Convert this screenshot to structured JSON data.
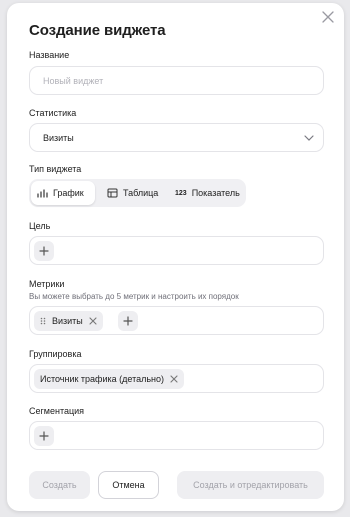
{
  "dialog": {
    "title": "Создание виджета",
    "close_icon": "close-icon"
  },
  "name": {
    "label": "Название",
    "placeholder": "Новый виджет",
    "value": ""
  },
  "statistics": {
    "label": "Статистика",
    "selected": "Визиты",
    "icon": "chevron-down-icon"
  },
  "widget_type": {
    "label": "Тип виджета",
    "options": [
      {
        "label": "График",
        "icon": "bar-chart-icon",
        "active": true
      },
      {
        "label": "Таблица",
        "icon": "table-icon",
        "active": false
      },
      {
        "label": "Показатель",
        "icon_text": "123",
        "active": false
      }
    ]
  },
  "goal": {
    "label": "Цель",
    "add_icon": "plus-icon"
  },
  "metrics": {
    "label": "Метрики",
    "hint": "Вы можете выбрать до 5 метрик и настроить их порядок",
    "chips": [
      {
        "label": "Визиты"
      }
    ]
  },
  "grouping": {
    "label": "Группировка",
    "chips": [
      {
        "label": "Источник трафика (детально)"
      }
    ]
  },
  "segmentation": {
    "label": "Сегментация",
    "add_icon": "plus-icon"
  },
  "footer": {
    "create_label": "Создать",
    "cancel_label": "Отмена",
    "create_edit_label": "Создать и отредактировать"
  },
  "colors": {
    "background": "#e9e9ec",
    "dialog": "#ffffff",
    "chip": "#eeeef1",
    "disabled_text": "#a3a3aa",
    "border": "#e4e4e8"
  }
}
